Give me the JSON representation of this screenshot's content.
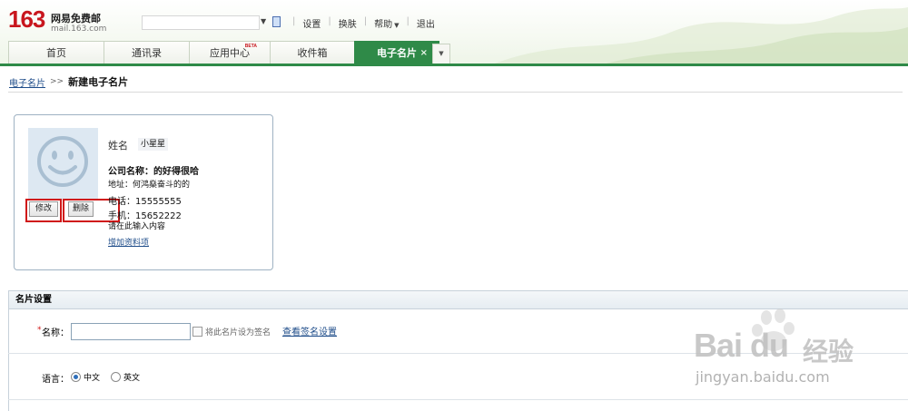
{
  "header": {
    "logo_number": "163",
    "logo_text": "网易免费邮",
    "logo_domain": "mail.163.com",
    "links": [
      "设置",
      "换肤",
      "帮助",
      "退出"
    ]
  },
  "tabs": [
    {
      "label": "首页",
      "width": 104
    },
    {
      "label": "通讯录",
      "width": 93
    },
    {
      "label": "应用中心",
      "width": 88,
      "badge": "BETA"
    },
    {
      "label": "收件箱",
      "width": 92
    },
    {
      "label": "电子名片",
      "width": 92,
      "active": true
    }
  ],
  "tab_close": "×",
  "breadcrumb": {
    "parent": "电子名片",
    "separator": ">>",
    "current": "新建电子名片"
  },
  "card": {
    "name_label": "姓名",
    "name_value": "小星星",
    "company": "公司名称：的好得很哈",
    "address": "地址：何鸿燊奋斗的的",
    "phone": "电话：15555555",
    "mobile": "手机：15652222",
    "hint": "请在此输入内容",
    "add_more": "增加资料项",
    "edit_button": "修改",
    "delete_button": "删除"
  },
  "settings": {
    "title": "名片设置",
    "required_mark": "*",
    "name_label": "名称：",
    "name_value": "",
    "signature_checkbox_label": "将此名片设为签名",
    "signature_link": "查看签名设置",
    "language_label": "语言：",
    "languages": [
      "中文",
      "英文"
    ],
    "selected_language": "中文"
  },
  "watermark": {
    "brand": "Bai du",
    "cn": "经验",
    "domain": "jingyan.baidu.com"
  },
  "colors": {
    "accent_green": "#2f8a48",
    "logo_red": "#c8161d",
    "link_blue": "#1f4d8a",
    "highlight_red": "#d01818"
  }
}
